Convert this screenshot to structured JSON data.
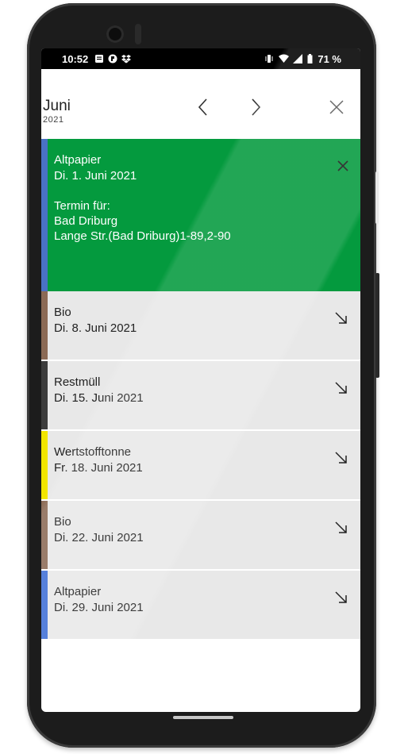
{
  "status_bar": {
    "time": "10:52",
    "battery": "71 %",
    "left_icons": [
      "notification-icon",
      "app-icon",
      "dropbox-icon"
    ],
    "right_icons": [
      "vibrate-icon",
      "wifi-icon",
      "signal-icon",
      "battery-icon"
    ]
  },
  "header": {
    "month": "Juni",
    "year": "2021",
    "prev_icon": "chevron-left-icon",
    "next_icon": "chevron-right-icon",
    "close_icon": "close-icon"
  },
  "entries": [
    {
      "title": "Altpapier",
      "date": "Di. 1. Juni 2021",
      "expanded": true,
      "stripe_color": "#4a72c4",
      "detail_label": "Termin für:",
      "detail_city": "Bad Driburg",
      "detail_street": "Lange Str.(Bad Driburg)1-89,2-90"
    },
    {
      "title": "Bio",
      "date": "Di. 8. Juni 2021",
      "stripe_color": "#8b6a55"
    },
    {
      "title": "Restmüll",
      "date": "Di. 15. Juni 2021",
      "stripe_color": "#3c3c3c"
    },
    {
      "title": "Wertstofftonne",
      "date": "Fr. 18. Juni 2021",
      "stripe_color": "#f2e500"
    },
    {
      "title": "Bio",
      "date": "Di. 22. Juni 2021",
      "stripe_color": "#8b6a55"
    },
    {
      "title": "Altpapier",
      "date": "Di. 29. Juni 2021",
      "stripe_color": "#3f6fd6"
    }
  ],
  "colors": {
    "expanded_bg": "#049a3e",
    "row_bg": "#e8e8e8"
  }
}
